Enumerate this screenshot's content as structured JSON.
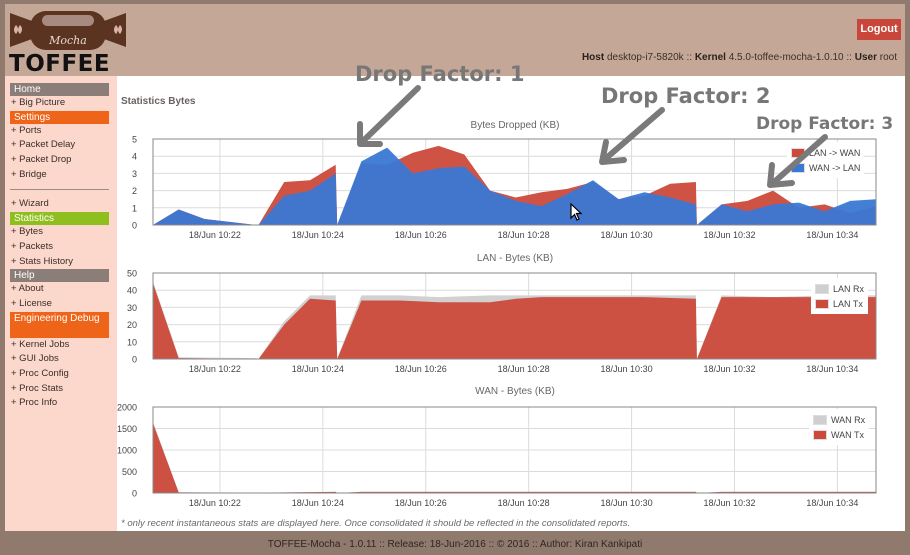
{
  "header": {
    "logo_script": "Mocha",
    "logo_word": "TOFFEE",
    "logout_label": "Logout",
    "host_label": "Host",
    "host_value": "desktop-i7-5820k",
    "kernel_label": "Kernel",
    "kernel_value": "4.5.0-toffee-mocha-1.0.10",
    "user_label": "User",
    "user_value": "root",
    "separator": "::"
  },
  "sidebar": {
    "sections": [
      {
        "header": "Home",
        "color": "gray",
        "items": [
          "+ Big Picture"
        ]
      },
      {
        "header": "Settings",
        "color": "orange",
        "items": [
          "+ Ports",
          "+ Packet Delay",
          "+ Packet Drop",
          "+ Bridge"
        ],
        "separator_after": true,
        "items_after": [
          "+ Wizard"
        ]
      },
      {
        "header": "Statistics",
        "color": "green",
        "items": [
          "+ Bytes",
          "+ Packets",
          "+ Stats History"
        ]
      },
      {
        "header": "Help",
        "color": "gray",
        "items": [
          "+ About",
          "+ License"
        ]
      },
      {
        "header": "Engineering Debug",
        "color": "orange",
        "items": [
          "+ Kernel Jobs",
          "+ GUI Jobs",
          "+ Proc Config",
          "+ Proc Stats",
          "+ Proc Info"
        ]
      }
    ]
  },
  "main": {
    "page_title": "Statistics Bytes",
    "note": "* only recent instantaneous stats are displayed here. Once consolidated it should be reflected in the consolidated reports."
  },
  "annotations": [
    {
      "text": "Drop Factor: 1"
    },
    {
      "text": "Drop Factor: 2"
    },
    {
      "text": "Drop Factor: 3"
    }
  ],
  "colors": {
    "red": "#cc4a3b",
    "blue": "#3a78d4",
    "gray": "#cfcfcf",
    "grid": "#dcdcdc"
  },
  "chart_data": [
    {
      "type": "area",
      "title": "Bytes Dropped (KB)",
      "xlabel": "",
      "ylabel": "",
      "ylim": [
        0,
        5
      ],
      "yticks": [
        "0",
        "1",
        "2",
        "3",
        "4",
        "5"
      ],
      "xlim_minutes_after_10_20": [
        0.7,
        14.75
      ],
      "xticks": [
        {
          "label": "18/Jun 10:22",
          "minute": 2
        },
        {
          "label": "18/Jun 10:24",
          "minute": 4
        },
        {
          "label": "18/Jun 10:26",
          "minute": 6
        },
        {
          "label": "18/Jun 10:28",
          "minute": 8
        },
        {
          "label": "18/Jun 10:30",
          "minute": 10
        },
        {
          "label": "18/Jun 10:32",
          "minute": 12
        },
        {
          "label": "18/Jun 10:34",
          "minute": 14
        }
      ],
      "grid": true,
      "legend": "top-right",
      "series": [
        {
          "name": "LAN -> WAN",
          "color": "#cc4a3b",
          "points": [
            [
              0.7,
              0
            ],
            [
              1.2,
              0.9
            ],
            [
              1.7,
              0.35
            ],
            [
              2.7,
              0
            ],
            [
              2.75,
              0
            ],
            [
              3.25,
              2.5
            ],
            [
              3.75,
              2.6
            ],
            [
              4.25,
              3.5
            ],
            [
              4.28,
              0
            ],
            [
              4.75,
              3.6
            ],
            [
              5.25,
              3.5
            ],
            [
              5.75,
              4.2
            ],
            [
              6.25,
              4.6
            ],
            [
              6.75,
              4.1
            ],
            [
              7.25,
              2.0
            ],
            [
              7.75,
              1.6
            ],
            [
              8.25,
              1.9
            ],
            [
              8.75,
              2.1
            ],
            [
              9.25,
              2.5
            ],
            [
              9.75,
              1.5
            ],
            [
              10.25,
              1.7
            ],
            [
              10.75,
              2.4
            ],
            [
              11.25,
              2.5
            ],
            [
              11.27,
              0
            ],
            [
              11.75,
              1.2
            ],
            [
              12.25,
              1.4
            ],
            [
              12.75,
              2.0
            ],
            [
              13.25,
              1.0
            ],
            [
              13.75,
              1.2
            ],
            [
              14.25,
              0.7
            ],
            [
              14.75,
              1.1
            ]
          ]
        },
        {
          "name": "WAN -> LAN",
          "color": "#3a78d4",
          "points": [
            [
              0.7,
              0
            ],
            [
              1.2,
              0.9
            ],
            [
              1.7,
              0.35
            ],
            [
              2.7,
              0
            ],
            [
              2.75,
              0
            ],
            [
              3.25,
              1.7
            ],
            [
              3.75,
              2.0
            ],
            [
              4.25,
              3.0
            ],
            [
              4.28,
              0
            ],
            [
              4.75,
              3.7
            ],
            [
              5.25,
              4.5
            ],
            [
              5.75,
              3.0
            ],
            [
              6.25,
              3.3
            ],
            [
              6.75,
              3.4
            ],
            [
              7.25,
              2.0
            ],
            [
              7.75,
              1.4
            ],
            [
              8.25,
              1.1
            ],
            [
              8.75,
              1.8
            ],
            [
              9.25,
              2.6
            ],
            [
              9.75,
              1.5
            ],
            [
              10.25,
              1.9
            ],
            [
              10.75,
              1.6
            ],
            [
              11.25,
              1.2
            ],
            [
              11.27,
              0
            ],
            [
              11.75,
              1.2
            ],
            [
              12.25,
              0.8
            ],
            [
              12.75,
              1.2
            ],
            [
              13.25,
              1.3
            ],
            [
              13.75,
              0.8
            ],
            [
              14.25,
              1.4
            ],
            [
              14.75,
              1.5
            ]
          ]
        }
      ]
    },
    {
      "type": "area",
      "title": "LAN - Bytes (KB)",
      "xlabel": "",
      "ylabel": "",
      "ylim": [
        0,
        50
      ],
      "yticks": [
        "0",
        "10",
        "20",
        "30",
        "40",
        "50"
      ],
      "xlim_minutes_after_10_20": [
        0.7,
        14.75
      ],
      "xticks": [
        {
          "label": "18/Jun 10:22",
          "minute": 2
        },
        {
          "label": "18/Jun 10:24",
          "minute": 4
        },
        {
          "label": "18/Jun 10:26",
          "minute": 6
        },
        {
          "label": "18/Jun 10:28",
          "minute": 8
        },
        {
          "label": "18/Jun 10:30",
          "minute": 10
        },
        {
          "label": "18/Jun 10:32",
          "minute": 12
        },
        {
          "label": "18/Jun 10:34",
          "minute": 14
        }
      ],
      "grid": true,
      "legend": "top-right",
      "series": [
        {
          "name": "LAN Rx",
          "color": "#cfcfcf",
          "points": [
            [
              0.7,
              45
            ],
            [
              1.2,
              1
            ],
            [
              2.7,
              0.5
            ],
            [
              2.75,
              0
            ],
            [
              3.25,
              22
            ],
            [
              3.75,
              37
            ],
            [
              4.25,
              37
            ],
            [
              4.28,
              0
            ],
            [
              4.75,
              37
            ],
            [
              5.5,
              37
            ],
            [
              6.25,
              36
            ],
            [
              7.25,
              37
            ],
            [
              8.25,
              37
            ],
            [
              9.25,
              37
            ],
            [
              10.25,
              37
            ],
            [
              11.25,
              37
            ],
            [
              11.27,
              0
            ],
            [
              11.75,
              37
            ],
            [
              12.75,
              36
            ],
            [
              13.75,
              37
            ],
            [
              14.75,
              37
            ]
          ]
        },
        {
          "name": "LAN Tx",
          "color": "#cc4a3b",
          "points": [
            [
              0.7,
              44
            ],
            [
              1.2,
              0.5
            ],
            [
              2.7,
              0
            ],
            [
              2.75,
              0
            ],
            [
              3.25,
              20
            ],
            [
              3.75,
              35
            ],
            [
              4.25,
              34
            ],
            [
              4.28,
              0
            ],
            [
              4.75,
              34
            ],
            [
              5.5,
              34
            ],
            [
              6.25,
              33
            ],
            [
              7.25,
              33
            ],
            [
              7.75,
              35
            ],
            [
              8.25,
              36
            ],
            [
              9.25,
              36
            ],
            [
              10.25,
              36
            ],
            [
              11.25,
              35
            ],
            [
              11.27,
              0
            ],
            [
              11.75,
              36
            ],
            [
              12.75,
              36
            ],
            [
              13.75,
              36
            ],
            [
              14.75,
              36
            ]
          ]
        }
      ]
    },
    {
      "type": "area",
      "title": "WAN - Bytes (KB)",
      "xlabel": "",
      "ylabel": "",
      "ylim": [
        0,
        2000
      ],
      "yticks": [
        "0",
        "500",
        "1000",
        "1500",
        "2000"
      ],
      "xlim_minutes_after_10_20": [
        0.7,
        14.75
      ],
      "xticks": [
        {
          "label": "18/Jun 10:22",
          "minute": 2
        },
        {
          "label": "18/Jun 10:24",
          "minute": 4
        },
        {
          "label": "18/Jun 10:26",
          "minute": 6
        },
        {
          "label": "18/Jun 10:28",
          "minute": 8
        },
        {
          "label": "18/Jun 10:30",
          "minute": 10
        },
        {
          "label": "18/Jun 10:32",
          "minute": 12
        },
        {
          "label": "18/Jun 10:34",
          "minute": 14
        }
      ],
      "grid": true,
      "legend": "top-right",
      "series": [
        {
          "name": "WAN Rx",
          "color": "#cfcfcf",
          "points": [
            [
              0.7,
              1650
            ],
            [
              1.2,
              20
            ],
            [
              2.7,
              10
            ],
            [
              4.25,
              30
            ],
            [
              4.28,
              0
            ],
            [
              4.75,
              30
            ],
            [
              11.25,
              30
            ],
            [
              11.27,
              0
            ],
            [
              11.75,
              30
            ],
            [
              14.75,
              30
            ]
          ]
        },
        {
          "name": "WAN Tx",
          "color": "#cc4a3b",
          "points": [
            [
              0.7,
              1620
            ],
            [
              1.2,
              15
            ],
            [
              2.7,
              5
            ],
            [
              4.25,
              25
            ],
            [
              4.28,
              0
            ],
            [
              4.75,
              25
            ],
            [
              11.25,
              25
            ],
            [
              11.27,
              0
            ],
            [
              11.75,
              25
            ],
            [
              14.75,
              25
            ]
          ]
        }
      ]
    }
  ],
  "footer": {
    "text": "TOFFEE-Mocha - 1.0.11 :: Release: 18-Jun-2016 :: © 2016 :: Author: Kiran Kankipati"
  }
}
